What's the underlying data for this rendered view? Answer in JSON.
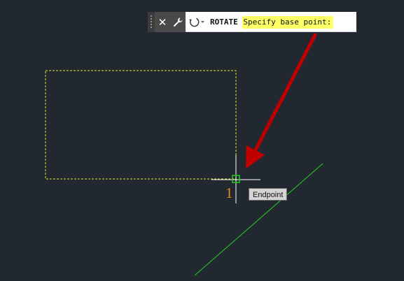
{
  "command_line": {
    "command_name": "ROTATE",
    "prompt": "Specify base point:",
    "prompt_highlight_color": "#ffff66",
    "icons": {
      "close": "close-icon",
      "settings": "wrench-icon",
      "recent_commands": "rotate-command-icon"
    }
  },
  "drawing": {
    "background_color": "#212830",
    "selection_outline_color": "#e8e03a",
    "line_color": "#1fd01f",
    "crosshair_color": "#ffffff"
  },
  "osnap": {
    "tooltip": "Endpoint",
    "marker_color": "#1fd01f"
  },
  "pick_counter": "1",
  "annotation": {
    "arrow_color": "#c00000"
  }
}
